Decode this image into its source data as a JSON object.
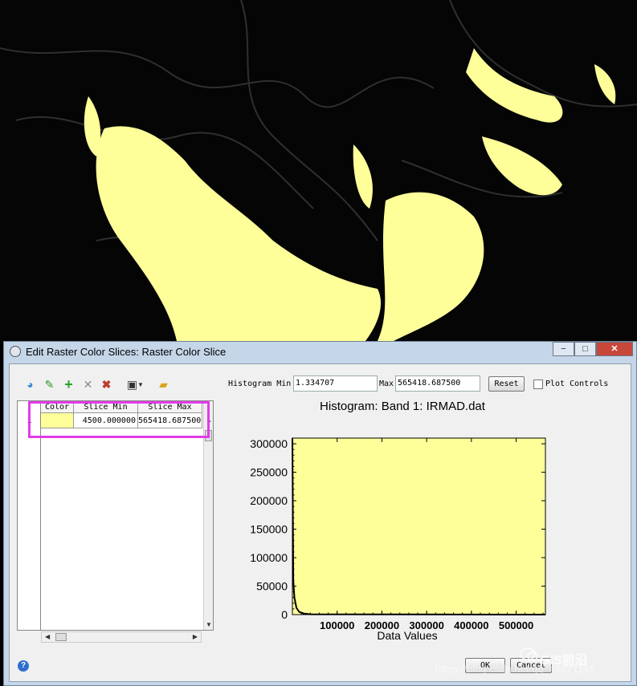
{
  "background": {
    "description_colors": {
      "dark": "#050505",
      "slice": "#ffff99"
    }
  },
  "window": {
    "title": "Edit Raster Color Slices: Raster Color Slice",
    "minimize": "−",
    "maximize": "□",
    "close": "✕"
  },
  "toolbar": {
    "icons": [
      "color-wheel-icon",
      "edit-palette-icon",
      "add-icon",
      "delete-icon",
      "delete-all-icon",
      "save-icon",
      "dropdown-arrow-icon",
      "open-folder-icon"
    ]
  },
  "table": {
    "headers": {
      "color": "Color",
      "slice_min": "Slice Min",
      "slice_max": "Slice Max"
    },
    "rows": [
      {
        "num": "1",
        "color": "#ffff99",
        "slice_min": "4500.000000",
        "slice_max": "565418.687500"
      }
    ]
  },
  "histogram_controls": {
    "min_label": "Histogram Min",
    "min_value": "1.334707",
    "max_label": "Max",
    "max_value": "565418.687500",
    "reset_label": "Reset",
    "plot_controls_label": "Plot Controls",
    "plot_controls_checked": false
  },
  "chart_data": {
    "type": "area",
    "title": "Histogram: Band 1: IRMAD.dat",
    "xlabel": "Data Values",
    "ylabel": "",
    "x_ticks": [
      100000,
      200000,
      300000,
      400000,
      500000
    ],
    "y_ticks": [
      0,
      50000,
      100000,
      150000,
      200000,
      250000,
      300000
    ],
    "xlim": [
      1.334707,
      565418.6875
    ],
    "ylim": [
      0,
      310000
    ],
    "fill_color": "#ffff99",
    "slice_range": [
      4500,
      565418.6875
    ],
    "series": [
      {
        "x": [
          0,
          2000,
          4500,
          9000,
          15000,
          25000,
          40000,
          565418
        ],
        "y": [
          310000,
          60000,
          30000,
          12000,
          5000,
          2000,
          500,
          0
        ]
      }
    ]
  },
  "footer": {
    "ok_label": "OK",
    "cancel_label": "Cancel",
    "help_icon": "?"
  },
  "watermark": {
    "brand": "GIS前沿",
    "url": "https://blog.csdn.net/qq_46071146"
  }
}
